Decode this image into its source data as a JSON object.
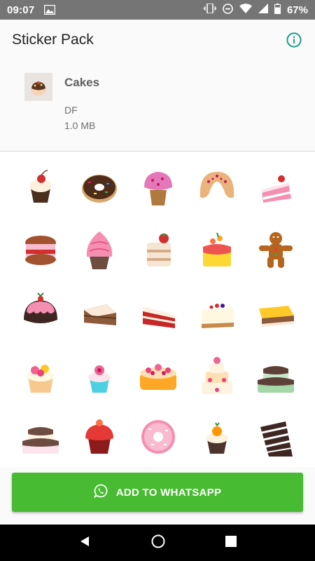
{
  "status_bar": {
    "time": "09:07",
    "battery": "67%"
  },
  "app_bar": {
    "title": "Sticker Pack",
    "info_icon": "info-icon",
    "accent": "#1d9a8a"
  },
  "pack": {
    "name": "Cakes",
    "publisher": "DF",
    "size": "1.0 MB"
  },
  "stickers": [
    "cupcake-cherry",
    "chocolate-donut",
    "pink-cupcake",
    "croissant",
    "strawberry-cake-slice",
    "macaron-sandwich",
    "pink-swirl-cupcake",
    "layer-cake-strawberry",
    "fruit-topped-cake",
    "gingerbread-man",
    "chocolate-pudding",
    "chocolate-slice",
    "red-velvet-slice",
    "cheesecake-slice",
    "lemon-tart-slice",
    "flower-cupcake",
    "mini-flower-cupcake",
    "round-flower-cake",
    "tiered-flower-cake",
    "tiered-mint-cake",
    "tiered-chocolate-cake",
    "red-cupcake",
    "pink-donut",
    "orange-cupcake",
    "black-forest-slice"
  ],
  "add_button": {
    "label": "ADD TO WHATSAPP",
    "color": "#47bb32"
  },
  "nav": {
    "back": "back-icon",
    "home": "home-icon",
    "recents": "recents-icon"
  }
}
